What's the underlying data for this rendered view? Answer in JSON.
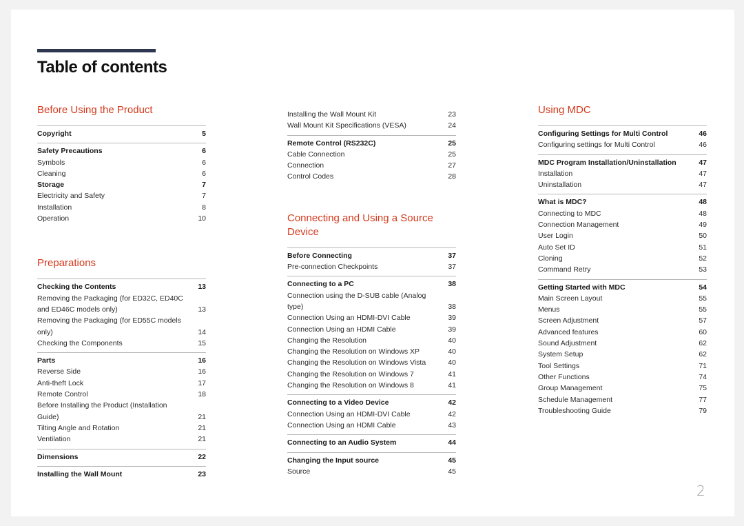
{
  "page_title": "Table of contents",
  "page_number": "2",
  "colors": {
    "heading_accent": "#d4391c",
    "title_bar": "#2e3650"
  },
  "col1": {
    "sections": [
      {
        "heading": "Before Using the Product",
        "groups": [
          {
            "rows": [
              {
                "label": "Copyright",
                "page": "5",
                "bold": true
              }
            ]
          },
          {
            "rows": [
              {
                "label": "Safety Precautions",
                "page": "6",
                "bold": true
              },
              {
                "label": "Symbols",
                "page": "6"
              },
              {
                "label": "Cleaning",
                "page": "6"
              },
              {
                "label": "Storage",
                "page": "7",
                "bold": true
              },
              {
                "label": "Electricity and Safety",
                "page": "7"
              },
              {
                "label": "Installation",
                "page": "8"
              },
              {
                "label": "Operation",
                "page": "10"
              }
            ]
          }
        ]
      },
      {
        "heading": "Preparations",
        "groups": [
          {
            "rows": [
              {
                "label": "Checking the Contents",
                "page": "13",
                "bold": true
              },
              {
                "label": "Removing the Packaging (for ED32C, ED40C and ED46C models only)",
                "page": "13"
              },
              {
                "label": "Removing the Packaging (for ED55C models only)",
                "page": "14"
              },
              {
                "label": "Checking the Components",
                "page": "15"
              }
            ]
          },
          {
            "rows": [
              {
                "label": "Parts",
                "page": "16",
                "bold": true
              },
              {
                "label": "Reverse Side",
                "page": "16"
              },
              {
                "label": "Anti-theft Lock",
                "page": "17"
              },
              {
                "label": "Remote Control",
                "page": "18"
              },
              {
                "label": "Before Installing the Product (Installation Guide)",
                "page": "21"
              },
              {
                "label": "Tilting Angle and Rotation",
                "page": "21"
              },
              {
                "label": "Ventilation",
                "page": "21"
              }
            ]
          },
          {
            "rows": [
              {
                "label": "Dimensions",
                "page": "22",
                "bold": true
              }
            ]
          },
          {
            "rows": [
              {
                "label": "Installing the Wall Mount",
                "page": "23",
                "bold": true
              }
            ]
          }
        ]
      }
    ]
  },
  "col2": {
    "sections": [
      {
        "heading": "",
        "groups": [
          {
            "rows": [
              {
                "label": "Installing the Wall Mount Kit",
                "page": "23"
              },
              {
                "label": "Wall Mount Kit Specifications (VESA)",
                "page": "24"
              }
            ]
          },
          {
            "rows": [
              {
                "label": "Remote Control (RS232C)",
                "page": "25",
                "bold": true
              },
              {
                "label": "Cable Connection",
                "page": "25"
              },
              {
                "label": "Connection",
                "page": "27"
              },
              {
                "label": "Control Codes",
                "page": "28"
              }
            ]
          }
        ]
      },
      {
        "heading": "Connecting and Using a Source Device",
        "groups": [
          {
            "rows": [
              {
                "label": "Before Connecting",
                "page": "37",
                "bold": true
              },
              {
                "label": "Pre-connection Checkpoints",
                "page": "37"
              }
            ]
          },
          {
            "rows": [
              {
                "label": "Connecting to a PC",
                "page": "38",
                "bold": true
              },
              {
                "label": "Connection using the D-SUB cable (Analog type)",
                "page": "38"
              },
              {
                "label": "Connection Using an HDMI-DVI Cable",
                "page": "39"
              },
              {
                "label": "Connection Using an HDMI Cable",
                "page": "39"
              },
              {
                "label": "Changing the Resolution",
                "page": "40"
              },
              {
                "label": "Changing the Resolution on Windows XP",
                "page": "40"
              },
              {
                "label": "Changing the Resolution on Windows Vista",
                "page": "40"
              },
              {
                "label": "Changing the Resolution on Windows 7",
                "page": "41"
              },
              {
                "label": "Changing the Resolution on Windows 8",
                "page": "41"
              }
            ]
          },
          {
            "rows": [
              {
                "label": "Connecting to a Video Device",
                "page": "42",
                "bold": true
              },
              {
                "label": "Connection Using an HDMI-DVI Cable",
                "page": "42"
              },
              {
                "label": "Connection Using an HDMI Cable",
                "page": "43"
              }
            ]
          },
          {
            "rows": [
              {
                "label": "Connecting to an Audio System",
                "page": "44",
                "bold": true
              }
            ]
          },
          {
            "rows": [
              {
                "label": "Changing the Input source",
                "page": "45",
                "bold": true
              },
              {
                "label": "Source",
                "page": "45"
              }
            ]
          }
        ]
      }
    ]
  },
  "col3": {
    "sections": [
      {
        "heading": "Using MDC",
        "groups": [
          {
            "rows": [
              {
                "label": "Configuring Settings for Multi Control",
                "page": "46",
                "bold": true
              },
              {
                "label": "Configuring settings for Multi Control",
                "page": "46"
              }
            ]
          },
          {
            "rows": [
              {
                "label": "MDC Program Installation/Uninstallation",
                "page": "47",
                "bold": true
              },
              {
                "label": "Installation",
                "page": "47"
              },
              {
                "label": "Uninstallation",
                "page": "47"
              }
            ]
          },
          {
            "rows": [
              {
                "label": "What is MDC?",
                "page": "48",
                "bold": true
              },
              {
                "label": "Connecting to MDC",
                "page": "48"
              },
              {
                "label": "Connection Management",
                "page": "49"
              },
              {
                "label": "User Login",
                "page": "50"
              },
              {
                "label": "Auto Set ID",
                "page": "51"
              },
              {
                "label": "Cloning",
                "page": "52"
              },
              {
                "label": "Command Retry",
                "page": "53"
              }
            ]
          },
          {
            "rows": [
              {
                "label": "Getting Started with MDC",
                "page": "54",
                "bold": true
              },
              {
                "label": "Main Screen Layout",
                "page": "55"
              },
              {
                "label": "Menus",
                "page": "55"
              },
              {
                "label": "Screen Adjustment",
                "page": "57"
              },
              {
                "label": "Advanced features",
                "page": "60"
              },
              {
                "label": "Sound Adjustment",
                "page": "62"
              },
              {
                "label": "System Setup",
                "page": "62"
              },
              {
                "label": "Tool Settings",
                "page": "71"
              },
              {
                "label": "Other Functions",
                "page": "74"
              },
              {
                "label": "Group Management",
                "page": "75"
              },
              {
                "label": "Schedule Management",
                "page": "77"
              },
              {
                "label": "Troubleshooting Guide",
                "page": "79"
              }
            ]
          }
        ]
      }
    ]
  }
}
